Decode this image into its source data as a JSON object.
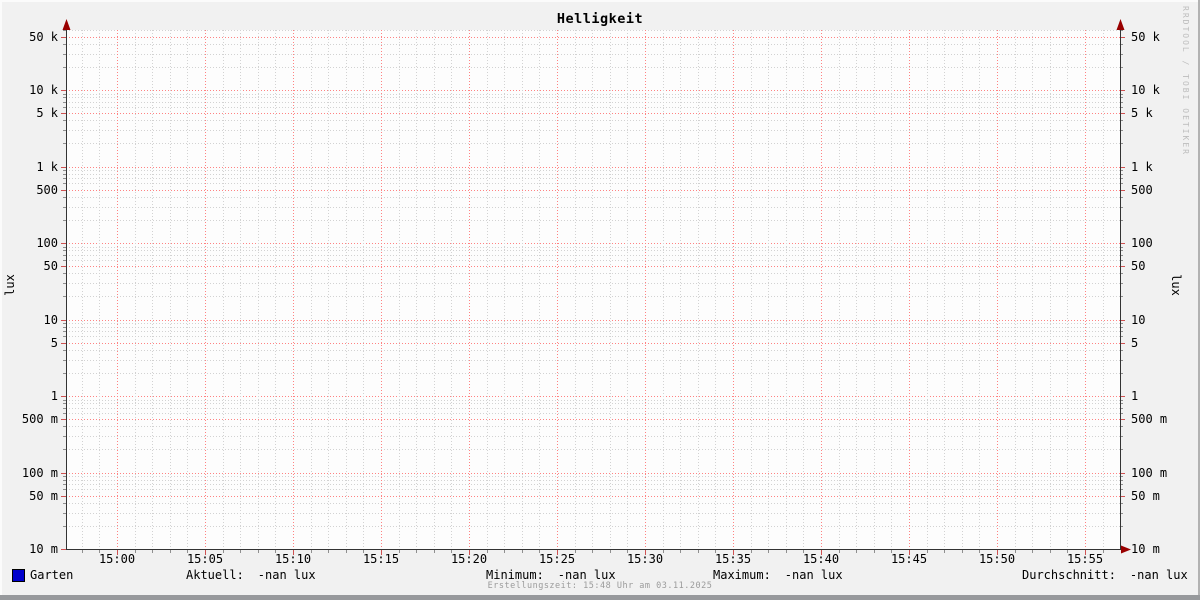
{
  "title": "Helligkeit",
  "watermark": "RRDTOOL / TOBI OETIKER",
  "footer": "Erstellungszeit: 15:48 Uhr am 03.11.2025",
  "legend": {
    "series": {
      "label": "Garten",
      "color": "#0000cc"
    },
    "stats": [
      {
        "label": "Aktuell:",
        "value": "-nan lux"
      },
      {
        "label": "Minimum:",
        "value": "-nan lux"
      },
      {
        "label": "Maximum:",
        "value": "-nan lux"
      },
      {
        "label": "Durchschnitt:",
        "value": "-nan lux"
      }
    ]
  },
  "colors": {
    "canvas_bg": "#f1f1f1",
    "plot_bg": "#fdfdfd",
    "grid_major": "#ff8282",
    "grid_minor": "#d2d2d2",
    "axis": "#333333",
    "arrow": "#990000",
    "tick_major": "#cf5151",
    "tick_minor": "#8f8f8f",
    "series": "#0000cc",
    "muted_text": "#9b9b9b"
  },
  "chart_data": {
    "type": "line",
    "title": "Helligkeit",
    "xlabel": "",
    "ylabel": "lux",
    "y_scale": "logarithmic",
    "ylim": [
      0.01,
      61000
    ],
    "x_range": [
      "14:57",
      "15:57"
    ],
    "x_tick_interval_minutes": 5,
    "x_minor_interval_minutes": 1,
    "grid": "major grid (red dotted) at 1 and 5 of each decade and every 5 minutes; minor grid (gray dotted) at 2,3,4,6,7,8,9 of each decade and every minute",
    "legend_position": "bottom",
    "x_ticks": [
      "15:00",
      "15:05",
      "15:10",
      "15:15",
      "15:20",
      "15:25",
      "15:30",
      "15:35",
      "15:40",
      "15:45",
      "15:50",
      "15:55"
    ],
    "y_ticks": [
      {
        "label": "50 k",
        "value": 50000
      },
      {
        "label": "10 k",
        "value": 10000
      },
      {
        "label": "5 k",
        "value": 5000
      },
      {
        "label": "1 k",
        "value": 1000
      },
      {
        "label": "500",
        "value": 500
      },
      {
        "label": "100",
        "value": 100
      },
      {
        "label": "50",
        "value": 50
      },
      {
        "label": "10",
        "value": 10
      },
      {
        "label": "5",
        "value": 5
      },
      {
        "label": "1",
        "value": 1
      },
      {
        "label": "500 m",
        "value": 0.5
      },
      {
        "label": "100 m",
        "value": 0.1
      },
      {
        "label": "50 m",
        "value": 0.05
      },
      {
        "label": "10 m",
        "value": 0.01
      }
    ],
    "series": [
      {
        "name": "Garten",
        "color": "#0000cc",
        "values": [],
        "note": "no data in window; Aktuell/Minimum/Maximum/Durchschnitt all -nan lux"
      }
    ]
  }
}
